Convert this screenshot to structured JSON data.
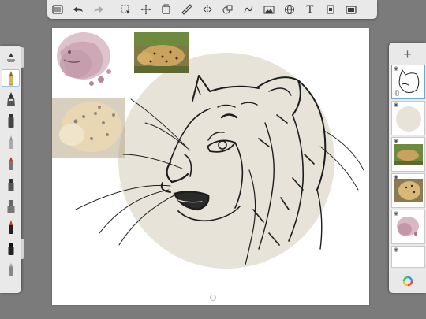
{
  "toolbar": {
    "items": [
      {
        "name": "menu-icon"
      },
      {
        "name": "undo-icon"
      },
      {
        "name": "redo-icon",
        "disabled": true
      },
      {
        "name": "selection-icon"
      },
      {
        "name": "transform-icon"
      },
      {
        "name": "fill-icon"
      },
      {
        "name": "ruler-icon"
      },
      {
        "name": "symmetry-icon"
      },
      {
        "name": "shape-icon"
      },
      {
        "name": "curve-icon"
      },
      {
        "name": "image-import-icon"
      },
      {
        "name": "perspective-icon"
      },
      {
        "name": "text-icon",
        "glyph": "T"
      },
      {
        "name": "copic-icon"
      },
      {
        "name": "fullscreen-icon"
      }
    ]
  },
  "brush_panel": {
    "items": [
      {
        "name": "brush-properties-icon"
      },
      {
        "name": "pencil-brush",
        "selected": true
      },
      {
        "name": "ballpoint-brush"
      },
      {
        "name": "marker-brush"
      },
      {
        "name": "paintbrush-brush"
      },
      {
        "name": "felt-tip-brush"
      },
      {
        "name": "airbrush-brush"
      },
      {
        "name": "chisel-brush"
      },
      {
        "name": "pen-brush"
      },
      {
        "name": "ink-brush"
      },
      {
        "name": "eraser-brush"
      }
    ]
  },
  "layers": {
    "add_label": "+",
    "items": [
      {
        "name": "layer-sketch",
        "selected": true
      },
      {
        "name": "layer-circle"
      },
      {
        "name": "layer-leopard-lying"
      },
      {
        "name": "layer-leopard-head"
      },
      {
        "name": "layer-watercolor"
      },
      {
        "name": "layer-empty"
      }
    ]
  },
  "colors": {
    "accent": "#6ea7e0",
    "circle": "#e7e3d8",
    "panel": "#e9e9e9"
  }
}
